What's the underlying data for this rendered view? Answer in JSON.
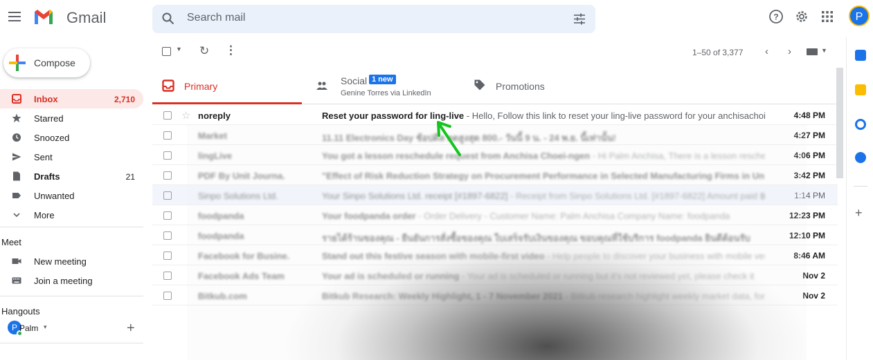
{
  "header": {
    "app_name": "Gmail",
    "search_placeholder": "Search mail",
    "avatar_initial": "P",
    "icons": [
      "menu-icon",
      "help-icon",
      "settings-icon",
      "apps-icon"
    ]
  },
  "sidebar": {
    "compose_label": "Compose",
    "items": [
      {
        "label": "Inbox",
        "count": "2,710",
        "icon": "inbox-icon",
        "active": true
      },
      {
        "label": "Starred",
        "count": "",
        "icon": "star-icon"
      },
      {
        "label": "Snoozed",
        "count": "",
        "icon": "clock-icon"
      },
      {
        "label": "Sent",
        "count": "",
        "icon": "send-icon"
      },
      {
        "label": "Drafts",
        "count": "21",
        "icon": "draft-icon",
        "bold": true
      },
      {
        "label": "Unwanted",
        "count": "",
        "icon": "label-icon"
      },
      {
        "label": "More",
        "count": "",
        "icon": "chevron-down-icon"
      }
    ],
    "meet": {
      "title": "Meet",
      "new_meeting": "New meeting",
      "join_meeting": "Join a meeting"
    },
    "hangouts": {
      "title": "Hangouts",
      "user_initial": "P",
      "user_name": "Palm",
      "add_label": "+"
    }
  },
  "toolbar": {
    "pagination": "1–50 of 3,377"
  },
  "tabs": {
    "primary": "Primary",
    "social": "Social",
    "social_badge": "1 new",
    "social_sub": "Genine Torres via LinkedIn",
    "promotions": "Promotions"
  },
  "emails": [
    {
      "sender": "noreply",
      "subject": "Reset your password for ling-live",
      "snippet": " - Hello, Follow this link to reset your ling-live password for your anchisachoie...",
      "time": "4:48 PM",
      "read": false,
      "blurred": false
    },
    {
      "sender": "Market",
      "subject": "11.11 Electronics Day ช้อปดีล ลดสูงสุด 800.- วันนี้ 9 น. - 24 พ.ย. นี้เท่านั้น!",
      "snippet": "",
      "time": "4:27 PM",
      "read": false,
      "blurred": true
    },
    {
      "sender": "lingLive",
      "subject": "You got a lesson reschedule request from Anchisa Choei-ngen",
      "snippet": " - Hi Palm Anchisa, There is a lesson reschedule",
      "time": "4:06 PM",
      "read": false,
      "blurred": true
    },
    {
      "sender": "PDF By Unit Journa.",
      "subject": "\"Effect of Risk Reduction Strategy on Procurement Performance in Selected Manufacturing Firms in Unite",
      "snippet": "",
      "time": "3:42 PM",
      "read": false,
      "blurred": true
    },
    {
      "sender": "Sinpo Solutions Ltd.",
      "subject": "Your Sinpo Solutions Ltd. receipt [#1897-6822]",
      "snippet": " - Receipt from Sinpo Solutions Ltd. [#1897-6822] Amount paid ฿...",
      "time": "1:14 PM",
      "read": true,
      "blurred": true
    },
    {
      "sender": "foodpanda",
      "subject": "Your foodpanda order",
      "snippet": " - Order Delivery - Customer Name: Palm Anchisa Company Name: foodpanda",
      "time": "12:23 PM",
      "read": false,
      "blurred": true
    },
    {
      "sender": "foodpanda",
      "subject": "รายได้ร้านของคุณ - ยืนยันการสั่งซื้อของคุณ ใบเสร็จรับเงินของคุณ ขอบคุณที่ใช้บริการ foodpanda ยินดีต้อนรับ",
      "snippet": "",
      "time": "12:10 PM",
      "read": false,
      "blurred": true
    },
    {
      "sender": "Facebook for Busine.",
      "subject": "Stand out this festive season with mobile-first video",
      "snippet": " - Help people to discover your business with mobile vertical",
      "time": "8:46 AM",
      "read": false,
      "blurred": true
    },
    {
      "sender": "Facebook Ads Team",
      "subject": "Your ad is scheduled or running",
      "snippet": " - Your ad is scheduled or running but it's not reviewed yet, please check it",
      "time": "Nov 2",
      "read": false,
      "blurred": true
    },
    {
      "sender": "Bitkub.com",
      "subject": "Bitkub Research: Weekly Highlight, 1 - 7 November 2021",
      "snippet": " - Bitkub research highlight weekly market data, for more info",
      "time": "Nov 2",
      "read": false,
      "blurred": true
    }
  ],
  "colors": {
    "accent_red": "#d93025",
    "blue": "#1a73e8",
    "search_bg": "#eaf1fb",
    "active_bg": "#fce8e6",
    "arrow_green": "#16c41f"
  }
}
